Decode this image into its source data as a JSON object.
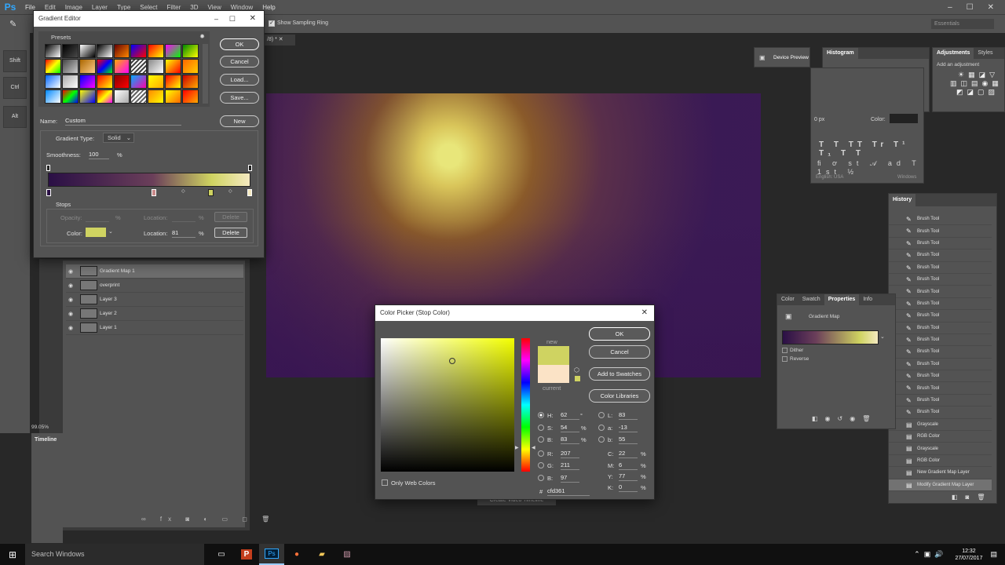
{
  "app": {
    "logo": "Ps",
    "menus": [
      "File",
      "Edit",
      "Image",
      "Layer",
      "Type",
      "Select",
      "Filter",
      "3D",
      "View",
      "Window",
      "Help"
    ]
  },
  "options": {
    "show_sampling_ring": "Show Sampling Ring",
    "workspace": "Essentials"
  },
  "modkeys": [
    "Shift",
    "Ctrl",
    "Alt"
  ],
  "doc": {
    "tab_suffix": "/8) *",
    "zoom": "99.05%"
  },
  "timeline": {
    "tab": "Timeline",
    "create_button": "Create Video Timeline"
  },
  "layers": [
    {
      "name": "Gradient Map 1",
      "selected": true
    },
    {
      "name": "overprint",
      "selected": false
    },
    {
      "name": "Layer 3",
      "selected": false
    },
    {
      "name": "Layer 2",
      "selected": false
    },
    {
      "name": "Layer 1",
      "selected": false
    }
  ],
  "panels": {
    "device_preview": "Device Preview",
    "histogram": "Histogram",
    "adjustments": "Adjustments",
    "styles": "Styles",
    "add_adjustment": "Add an adjustment",
    "history": "History",
    "char_language": "English: USA",
    "char_aa": "Windows",
    "char_tracking": "0 px",
    "char_color": "Color:",
    "props_tabs": [
      "Color",
      "Swatch",
      "Properties",
      "Info"
    ],
    "props_title": "Gradient Map",
    "dither": "Dither",
    "reverse": "Reverse"
  },
  "history": [
    "Brush Tool",
    "Brush Tool",
    "Brush Tool",
    "Brush Tool",
    "Brush Tool",
    "Brush Tool",
    "Brush Tool",
    "Brush Tool",
    "Brush Tool",
    "Brush Tool",
    "Brush Tool",
    "Brush Tool",
    "Brush Tool",
    "Brush Tool",
    "Brush Tool",
    "Brush Tool",
    "Brush Tool",
    "Grayscale",
    "RGB Color",
    "Grayscale",
    "RGB Color",
    "New Gradient Map Layer",
    "Modify Gradient Map Layer"
  ],
  "gradient_editor": {
    "title": "Gradient Editor",
    "presets_label": "Presets",
    "ok": "OK",
    "cancel": "Cancel",
    "load": "Load...",
    "save": "Save...",
    "name_label": "Name:",
    "name_value": "Custom",
    "new": "New",
    "type_label": "Gradient Type:",
    "type_value": "Solid",
    "smooth_label": "Smoothness:",
    "smooth_value": "100",
    "smooth_unit": "%",
    "stops_label": "Stops",
    "opacity_label": "Opacity:",
    "pct": "%",
    "location_label": "Location:",
    "delete": "Delete",
    "color_label": "Color:",
    "location_value": "81",
    "gradient_colors": [
      "#2a0f45",
      "#6b3f5a",
      "#cfd361",
      "#f4e9c0"
    ]
  },
  "color_picker": {
    "title": "Color Picker (Stop Color)",
    "ok": "OK",
    "cancel": "Cancel",
    "add_swatches": "Add to Swatches",
    "libraries": "Color Libraries",
    "new_label": "new",
    "current_label": "current",
    "new_color": "#cfd361",
    "current_color": "#fbe3c6",
    "only_web": "Only Web Colors",
    "h": "62",
    "h_unit": "°",
    "s": "54",
    "b": "83",
    "r": "207",
    "g": "211",
    "bl": "97",
    "l": "83",
    "a": "-13",
    "lab_b": "55",
    "c": "22",
    "m": "6",
    "y": "77",
    "k": "0",
    "hex": "cfd361"
  },
  "taskbar": {
    "search": "Search Windows",
    "time": "12:32",
    "date": "27/07/2017"
  }
}
